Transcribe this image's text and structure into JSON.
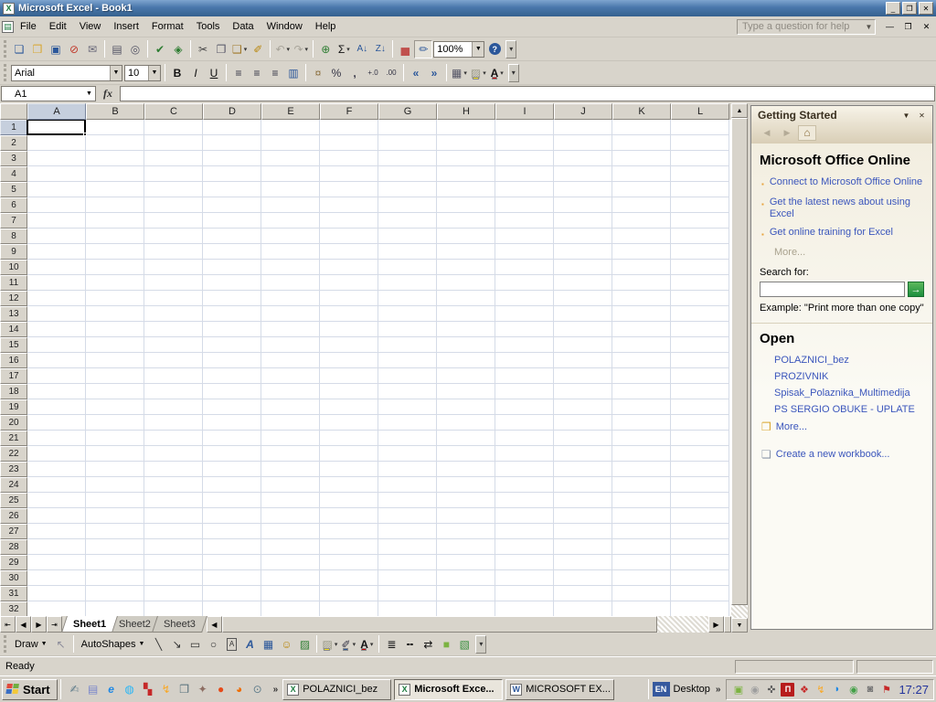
{
  "window": {
    "title": "Microsoft Excel - Book1"
  },
  "menu": {
    "items": [
      "File",
      "Edit",
      "View",
      "Insert",
      "Format",
      "Tools",
      "Data",
      "Window",
      "Help"
    ],
    "question_placeholder": "Type a question for help"
  },
  "toolbars": {
    "font": "Arial",
    "font_size": "10",
    "zoom": "100%",
    "draw_label": "Draw",
    "autoshapes_label": "AutoShapes",
    "standard": [
      "new",
      "open",
      "save",
      "permission",
      "email",
      "sep",
      "print",
      "print-preview",
      "sep",
      "spelling",
      "research",
      "sep",
      "cut",
      "copy",
      "paste",
      "format-painter",
      "sep",
      "undo",
      "redo",
      "sep",
      "hyperlink",
      "autosum",
      "sort-asc",
      "sort-desc",
      "sep",
      "chart-wizard",
      "drawing",
      "zoom-combo",
      "help",
      "overflow"
    ],
    "formatting": [
      "font-combo",
      "size-combo",
      "sep",
      "bold",
      "italic",
      "underline",
      "sep",
      "align-left",
      "align-center",
      "align-right",
      "merge-center",
      "sep",
      "currency",
      "percent",
      "comma",
      "increase-decimal",
      "decrease-decimal",
      "sep",
      "decrease-indent",
      "increase-indent",
      "sep",
      "borders",
      "fill-color",
      "font-color",
      "overflow"
    ],
    "drawing_bar": [
      "draw-menu",
      "select-objects",
      "sep",
      "autoshapes-menu",
      "line",
      "arrow",
      "rectangle",
      "oval",
      "text-box",
      "wordart",
      "diagram",
      "clipart",
      "picture",
      "sep",
      "fill-color",
      "line-color",
      "font-color2",
      "sep",
      "line-style",
      "dash-style",
      "arrow-style",
      "shadow",
      "three-d",
      "overflow"
    ]
  },
  "formula_bar": {
    "name_box": "A1",
    "fx_label": "fx",
    "value": ""
  },
  "grid": {
    "selected_cell": "A1",
    "columns": [
      "A",
      "B",
      "C",
      "D",
      "E",
      "F",
      "G",
      "H",
      "I",
      "J",
      "K",
      "L"
    ],
    "rows": [
      "1",
      "2",
      "3",
      "4",
      "5",
      "6",
      "7",
      "8",
      "9",
      "10",
      "11",
      "12",
      "13",
      "14",
      "15",
      "16",
      "17",
      "18",
      "19",
      "20",
      "21",
      "22",
      "23",
      "24",
      "25",
      "26",
      "27",
      "28",
      "29",
      "30",
      "31",
      "32"
    ]
  },
  "sheet_tabs": {
    "tabs": [
      "Sheet1",
      "Sheet2",
      "Sheet3"
    ],
    "active": "Sheet1"
  },
  "task_pane": {
    "title": "Getting Started",
    "office_online": {
      "heading": "Microsoft Office Online",
      "links": [
        "Connect to Microsoft Office Online",
        "Get the latest news about using Excel",
        "Get online training for Excel"
      ],
      "more": "More..."
    },
    "search": {
      "label": "Search for:",
      "example": "Example:  \"Print more than one copy\""
    },
    "open": {
      "heading": "Open",
      "files": [
        "POLAZNICI_bez",
        "PROZIVNIK",
        "Spisak_Polaznika_Multimedija",
        "PS SERGIO OBUKE - UPLATE"
      ],
      "more": "More...",
      "create": "Create a new workbook..."
    }
  },
  "status_bar": {
    "mode": "Ready"
  },
  "taskbar": {
    "start": "Start",
    "quicklaunch": [
      "pointer",
      "notes",
      "internet-explorer",
      "messenger",
      "floppy",
      "flash",
      "window",
      "tools",
      "opera",
      "media-player",
      "viewer"
    ],
    "tasks": [
      {
        "label": "POLAZNICI_bez",
        "app": "excel",
        "active": false
      },
      {
        "label": "Microsoft Exce...",
        "app": "excel",
        "active": true
      },
      {
        "label": "MICROSOFT EX...",
        "app": "word",
        "active": false
      }
    ],
    "language": "EN",
    "desktop_label": "Desktop",
    "tray": [
      "green-util",
      "gray-x",
      "mouse",
      "pi-app",
      "shield",
      "lightning",
      "chat",
      "net-off",
      "camera",
      "flag"
    ],
    "clock": "17:27"
  },
  "colors": {
    "titlebar_blue": "#4a77ab",
    "link_blue": "#3b56bc",
    "excel_green": "#1b7a3d",
    "clock_blue": "#23349c"
  }
}
